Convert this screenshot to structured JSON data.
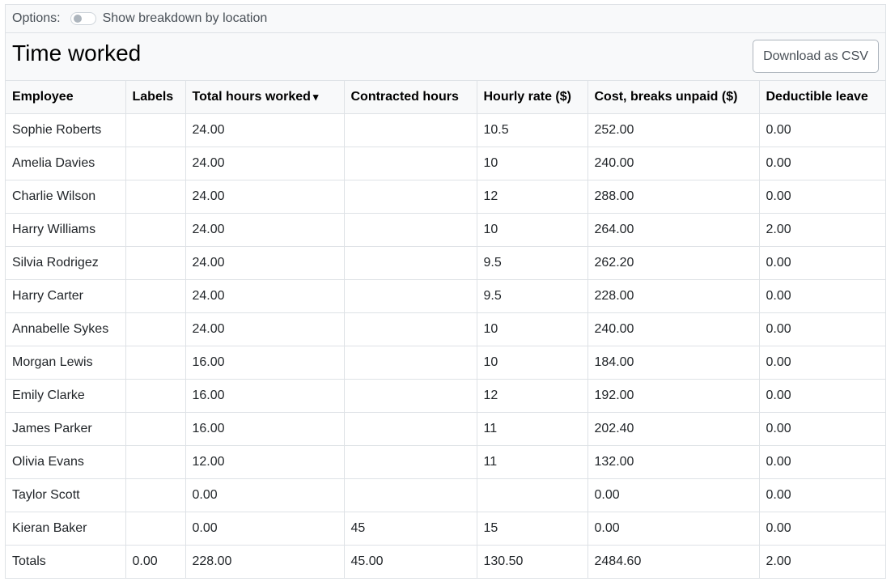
{
  "options": {
    "label": "Options:",
    "toggle_label": "Show breakdown by location",
    "toggle_on": false
  },
  "header": {
    "title": "Time worked",
    "download_label": "Download as CSV"
  },
  "table": {
    "columns": [
      {
        "label": "Employee",
        "sort": ""
      },
      {
        "label": "Labels",
        "sort": ""
      },
      {
        "label": "Total hours worked",
        "sort": "▾"
      },
      {
        "label": "Contracted hours",
        "sort": ""
      },
      {
        "label": "Hourly rate ($)",
        "sort": ""
      },
      {
        "label": "Cost, breaks unpaid ($)",
        "sort": ""
      },
      {
        "label": "Deductible leave",
        "sort": ""
      }
    ],
    "rows": [
      [
        "Sophie Roberts",
        "",
        "24.00",
        "",
        "10.5",
        "252.00",
        "0.00"
      ],
      [
        "Amelia Davies",
        "",
        "24.00",
        "",
        "10",
        "240.00",
        "0.00"
      ],
      [
        "Charlie Wilson",
        "",
        "24.00",
        "",
        "12",
        "288.00",
        "0.00"
      ],
      [
        "Harry Williams",
        "",
        "24.00",
        "",
        "10",
        "264.00",
        "2.00"
      ],
      [
        "Silvia Rodrigez",
        "",
        "24.00",
        "",
        "9.5",
        "262.20",
        "0.00"
      ],
      [
        "Harry Carter",
        "",
        "24.00",
        "",
        "9.5",
        "228.00",
        "0.00"
      ],
      [
        "Annabelle Sykes",
        "",
        "24.00",
        "",
        "10",
        "240.00",
        "0.00"
      ],
      [
        "Morgan Lewis",
        "",
        "16.00",
        "",
        "10",
        "184.00",
        "0.00"
      ],
      [
        "Emily Clarke",
        "",
        "16.00",
        "",
        "12",
        "192.00",
        "0.00"
      ],
      [
        "James Parker",
        "",
        "16.00",
        "",
        "11",
        "202.40",
        "0.00"
      ],
      [
        "Olivia Evans",
        "",
        "12.00",
        "",
        "11",
        "132.00",
        "0.00"
      ],
      [
        "Taylor Scott",
        "",
        "0.00",
        "",
        "",
        "0.00",
        "0.00"
      ],
      [
        "Kieran Baker",
        "",
        "0.00",
        "45",
        "15",
        "0.00",
        "0.00"
      ]
    ],
    "totals": [
      "Totals",
      "0.00",
      "228.00",
      "45.00",
      "130.50",
      "2484.60",
      "2.00"
    ]
  }
}
